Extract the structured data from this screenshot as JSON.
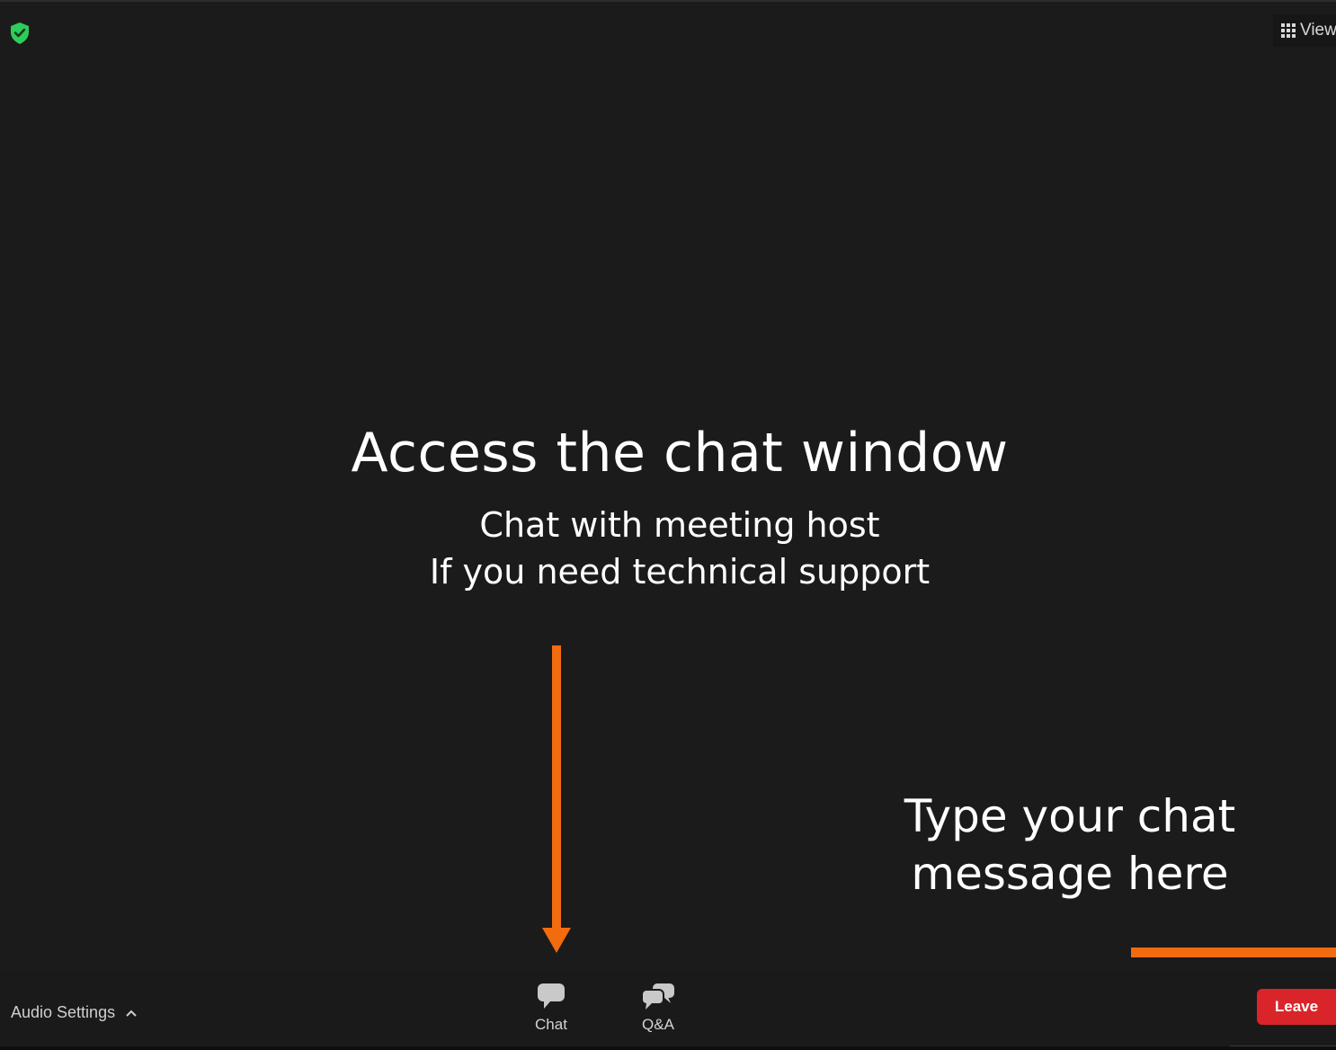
{
  "header": {
    "security_icon": "shield-check-icon",
    "security_color": "#2ecc5a",
    "view_label": "View",
    "view_icon": "grid-icon"
  },
  "instructions": {
    "headline": "Access the chat window",
    "line1": "Chat with meeting host",
    "line2": "If you need technical support"
  },
  "callout": {
    "line1": "Type your chat",
    "line2": "message here"
  },
  "annotation": {
    "color": "#f26b0f",
    "arrow_icon": "down-arrow",
    "leader_line": "horizontal-line"
  },
  "toolbar": {
    "audio_settings_label": "Audio Settings",
    "audio_settings_icon": "chevron-up-icon",
    "chat_label": "Chat",
    "chat_icon": "chat-bubble-icon",
    "qa_label": "Q&A",
    "qa_icon": "qa-bubbles-icon",
    "leave_label": "Leave",
    "leave_color": "#d9252a"
  }
}
